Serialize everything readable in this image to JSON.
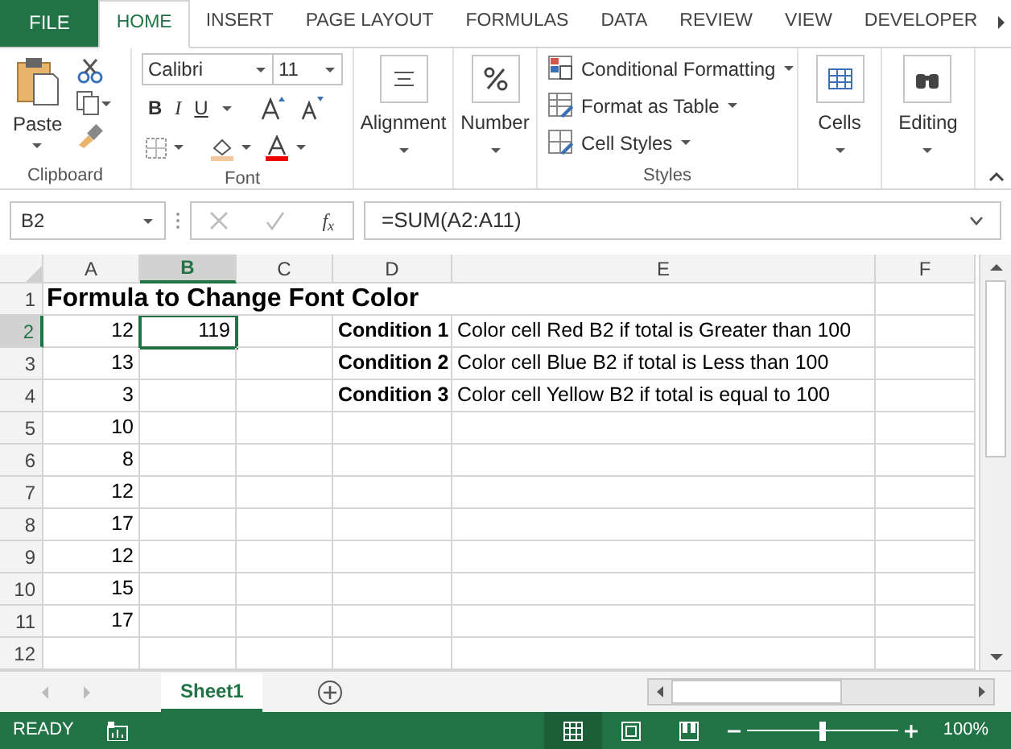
{
  "ribbon_tabs": [
    {
      "label": "FILE",
      "kind": "file",
      "selected": false
    },
    {
      "label": "HOME",
      "kind": "tab",
      "selected": true
    },
    {
      "label": "INSERT",
      "kind": "tab",
      "selected": false
    },
    {
      "label": "PAGE LAYOUT",
      "kind": "tab",
      "selected": false
    },
    {
      "label": "FORMULAS",
      "kind": "tab",
      "selected": false
    },
    {
      "label": "DATA",
      "kind": "tab",
      "selected": false
    },
    {
      "label": "REVIEW",
      "kind": "tab",
      "selected": false
    },
    {
      "label": "VIEW",
      "kind": "tab",
      "selected": false
    },
    {
      "label": "DEVELOPER",
      "kind": "tab",
      "selected": false
    }
  ],
  "ribbon": {
    "paste": "Paste",
    "clipboard": "Clipboard",
    "font_name": "Calibri",
    "font_size": "11",
    "bold": "B",
    "italic": "I",
    "underline": "U",
    "font": "Font",
    "alignment": "Alignment",
    "number": "Number",
    "styles_items": [
      "Conditional Formatting",
      "Format as Table",
      "Cell Styles"
    ],
    "styles": "Styles",
    "cells": "Cells",
    "editing": "Editing"
  },
  "formula_bar": {
    "name_box": "B2",
    "function_label": "f$_{x}$",
    "formula": "=SUM(A2:A11)"
  },
  "columns": [
    {
      "label": "A",
      "selected": false
    },
    {
      "label": "B",
      "selected": true
    },
    {
      "label": "C",
      "selected": false
    },
    {
      "label": "D",
      "selected": false
    },
    {
      "label": "E",
      "selected": false
    },
    {
      "label": "F",
      "selected": false
    }
  ],
  "title_row": {
    "number": "1",
    "text": "Formula to Change Font Color"
  },
  "rows": [
    {
      "number": "2",
      "selected": true,
      "a": "12",
      "b": "119",
      "d": "Condition 1",
      "e": "Color cell Red B2 if total is Greater than 100"
    },
    {
      "number": "3",
      "selected": false,
      "a": "13",
      "d": "Condition 2",
      "e": "Color cell Blue B2 if total is Less than 100"
    },
    {
      "number": "4",
      "selected": false,
      "a": "3",
      "d": "Condition 3",
      "e": "Color cell Yellow B2 if total is equal to 100"
    },
    {
      "number": "5",
      "selected": false,
      "a": "10"
    },
    {
      "number": "6",
      "selected": false,
      "a": "8"
    },
    {
      "number": "7",
      "selected": false,
      "a": "12"
    },
    {
      "number": "8",
      "selected": false,
      "a": "17"
    },
    {
      "number": "9",
      "selected": false,
      "a": "12"
    },
    {
      "number": "10",
      "selected": false,
      "a": "15"
    },
    {
      "number": "11",
      "selected": false,
      "a": "17"
    },
    {
      "number": "12",
      "selected": false
    }
  ],
  "sheet_tabs": [
    {
      "label": "Sheet1",
      "selected": true
    }
  ],
  "status_bar": {
    "status": "READY",
    "zoom": "100%",
    "zoom_slider": {
      "level": 0.5
    }
  }
}
